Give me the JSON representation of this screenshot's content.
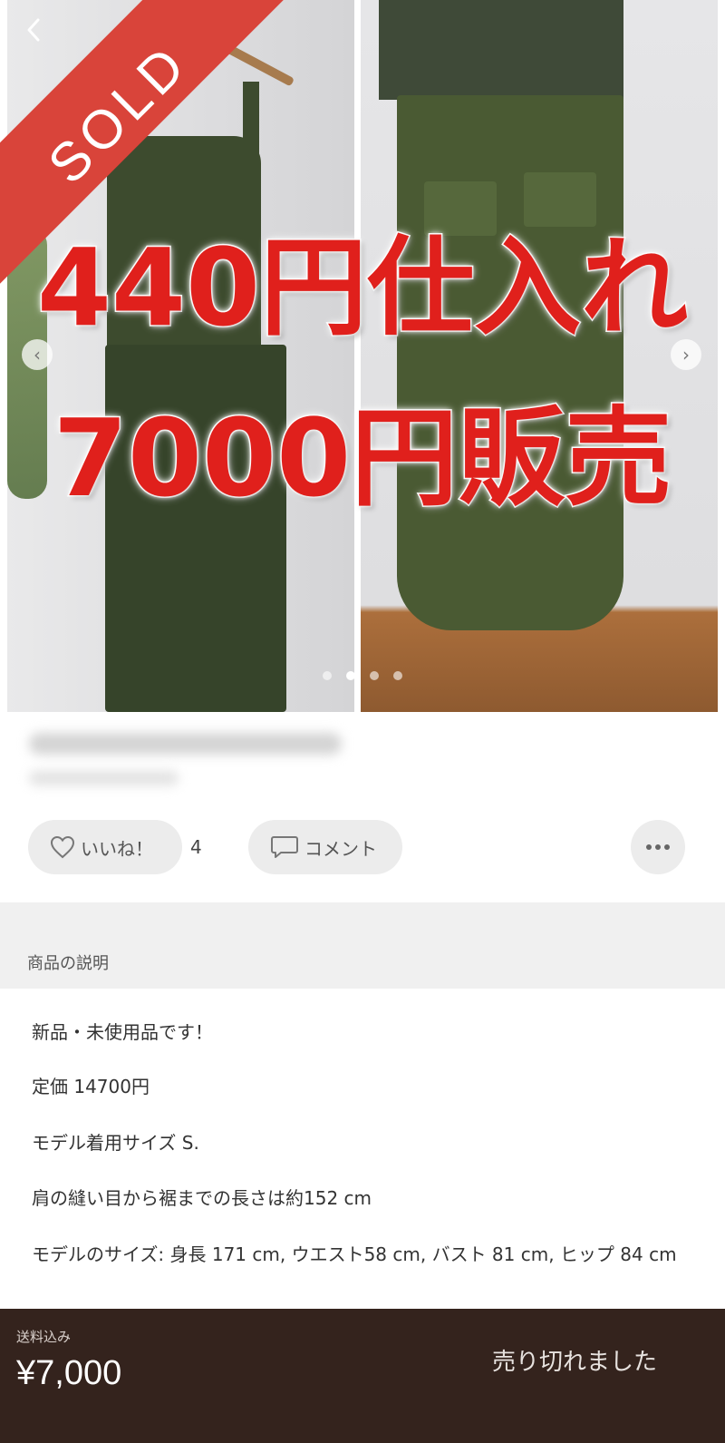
{
  "gallery": {
    "sold_label": "SOLD",
    "back_icon": "chevron-left-icon",
    "overlay_line1": "440円仕入れ",
    "overlay_line2": "7000円販売",
    "image_count": 4,
    "active_image_index": 1
  },
  "actions": {
    "like_label": "いいね！",
    "like_count": "4",
    "comment_label": "コメント",
    "more_icon": "more-horizontal-icon"
  },
  "description": {
    "section_title": "商品の説明",
    "lines": [
      "新品・未使用品です！",
      "定価 14700円",
      "モデル着用サイズ S.",
      "肩の縫い目から裾までの長さは約152 cm",
      "モデルのサイズ: 身長 171 cm, ウエスト58 cm, バスト 81 cm, ヒップ 84 cm"
    ]
  },
  "footer": {
    "shipping_label": "送料込み",
    "price": "¥7,000",
    "status": "売り切れました"
  },
  "colors": {
    "sold_red": "#d9443a",
    "overlay_red": "#e0201c",
    "footer_brown": "#34231d"
  }
}
